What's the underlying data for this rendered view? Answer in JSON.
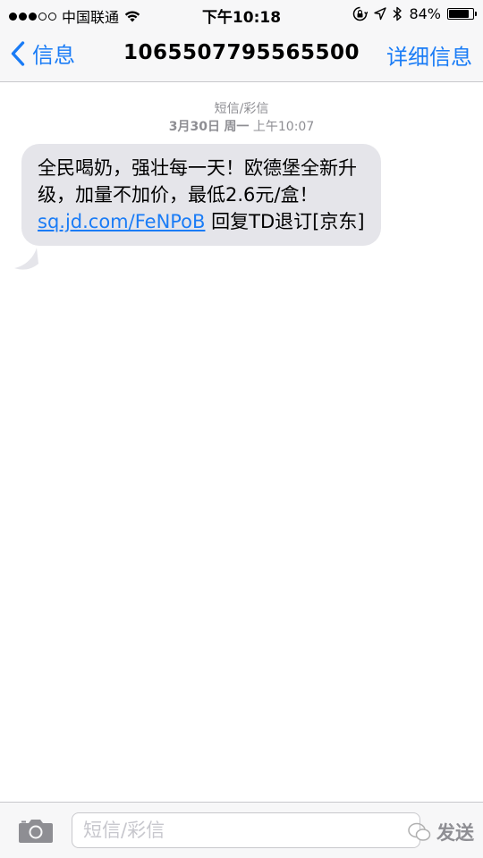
{
  "status_bar": {
    "carrier": "中国联通",
    "time": "下午10:18",
    "battery_pct": "84%",
    "battery_level": 0.84,
    "icons": [
      "signal-dots",
      "wifi-icon",
      "orientation-lock-icon",
      "location-arrow-icon",
      "bluetooth-icon",
      "battery-icon"
    ]
  },
  "nav": {
    "back_label": "信息",
    "title": "1065507795565500",
    "details_label": "详细信息"
  },
  "thread": {
    "message_type": "短信/彩信",
    "date": "3月30日",
    "weekday": "周一",
    "time": "上午10:07",
    "message": {
      "text_before_link": "全民喝奶，强壮每一天！欧德堡全新升级，加量不加价，最低2.6元/盒！ ",
      "link": "sq.jd.com/FeNPoB",
      "text_after_link": " 回复TD退订[京东]"
    }
  },
  "input_bar": {
    "placeholder": "短信/彩信",
    "send_label": "发送"
  },
  "colors": {
    "accent": "#1a7cf6",
    "bubble": "#e5e5ea",
    "bar_bg": "#f7f7f8",
    "meta_text": "#8e8e93"
  }
}
